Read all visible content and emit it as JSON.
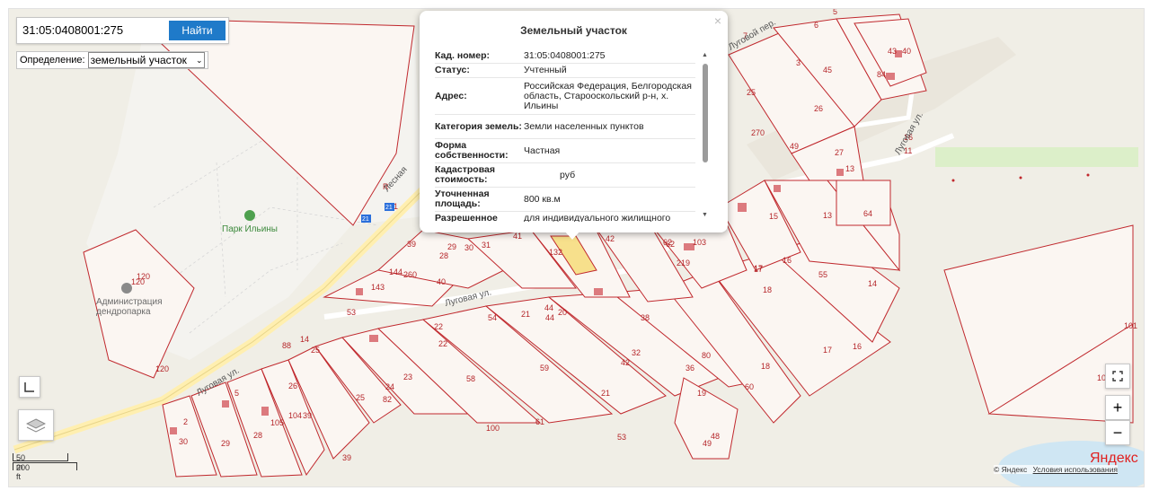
{
  "search": {
    "value": "31:05:0408001:275",
    "button": "Найти"
  },
  "definition": {
    "label": "Определение:",
    "selected": "земельный участок"
  },
  "popup": {
    "title": "Земельный участок",
    "close": "×",
    "rows": [
      {
        "key": "Кад. номер:",
        "value": "31:05:0408001:275"
      },
      {
        "key": "Статус:",
        "value": "Учтенный"
      },
      {
        "key": "Адрес:",
        "value": "Российская Федерация, Белгородская область, Старооскольский р-н, х. Ильины"
      },
      {
        "key": "Категория земель:",
        "value": "Земли населенных пунктов"
      },
      {
        "key": "Форма собственности:",
        "value": "Частная"
      },
      {
        "key": "Кадастровая стоимость:",
        "value": "руб"
      },
      {
        "key": "Уточненная площадь:",
        "value": "800 кв.м"
      },
      {
        "key": "Разрешенное",
        "value": "для индивидуального жилищного"
      }
    ]
  },
  "map": {
    "streets": [
      "Луговая ул.",
      "Луговая ул.",
      "Луговая ул.",
      "Лесная",
      "Луговой пер."
    ],
    "pois": {
      "park": "Парк Ильины",
      "admin": "Администрация дендропарка"
    },
    "parcel_numbers": [
      "43",
      "40",
      "84",
      "3",
      "45",
      "25",
      "26",
      "270",
      "49",
      "27",
      "13",
      "64",
      "15",
      "16",
      "13",
      "55",
      "14",
      "17",
      "17",
      "18",
      "18",
      "16",
      "60",
      "19",
      "36",
      "80",
      "38",
      "59",
      "61",
      "100",
      "53",
      "21",
      "44",
      "42",
      "32",
      "20",
      "54",
      "21",
      "44",
      "22",
      "22",
      "58",
      "23",
      "24",
      "82",
      "25",
      "26",
      "39",
      "39",
      "104",
      "105",
      "28",
      "29",
      "30",
      "2",
      "5",
      "88",
      "14",
      "25",
      "62",
      "120",
      "120",
      "120",
      "132",
      "41",
      "31",
      "30",
      "29",
      "28",
      "39",
      "144",
      "260",
      "143",
      "53",
      "40",
      "42",
      "103",
      "219",
      "62",
      "17",
      "49",
      "48",
      "101",
      "101",
      "6",
      "5",
      "7",
      "21",
      "R",
      "16",
      "11"
    ],
    "routes": [
      "21",
      "21"
    ]
  },
  "controls": {
    "zoom_in": "+",
    "zoom_out": "−",
    "scale_m": "50 m",
    "scale_ft": "200 ft"
  },
  "footer": {
    "logo": "Яндекс",
    "copyright": "© Яндекс",
    "terms": "Условия использования"
  },
  "colors": {
    "parcel_stroke": "#c0282d",
    "parcel_fill": "#fbf6f2",
    "selected_fill": "#f7e08c",
    "button": "#1f7ac9",
    "logo": "#e02020"
  }
}
